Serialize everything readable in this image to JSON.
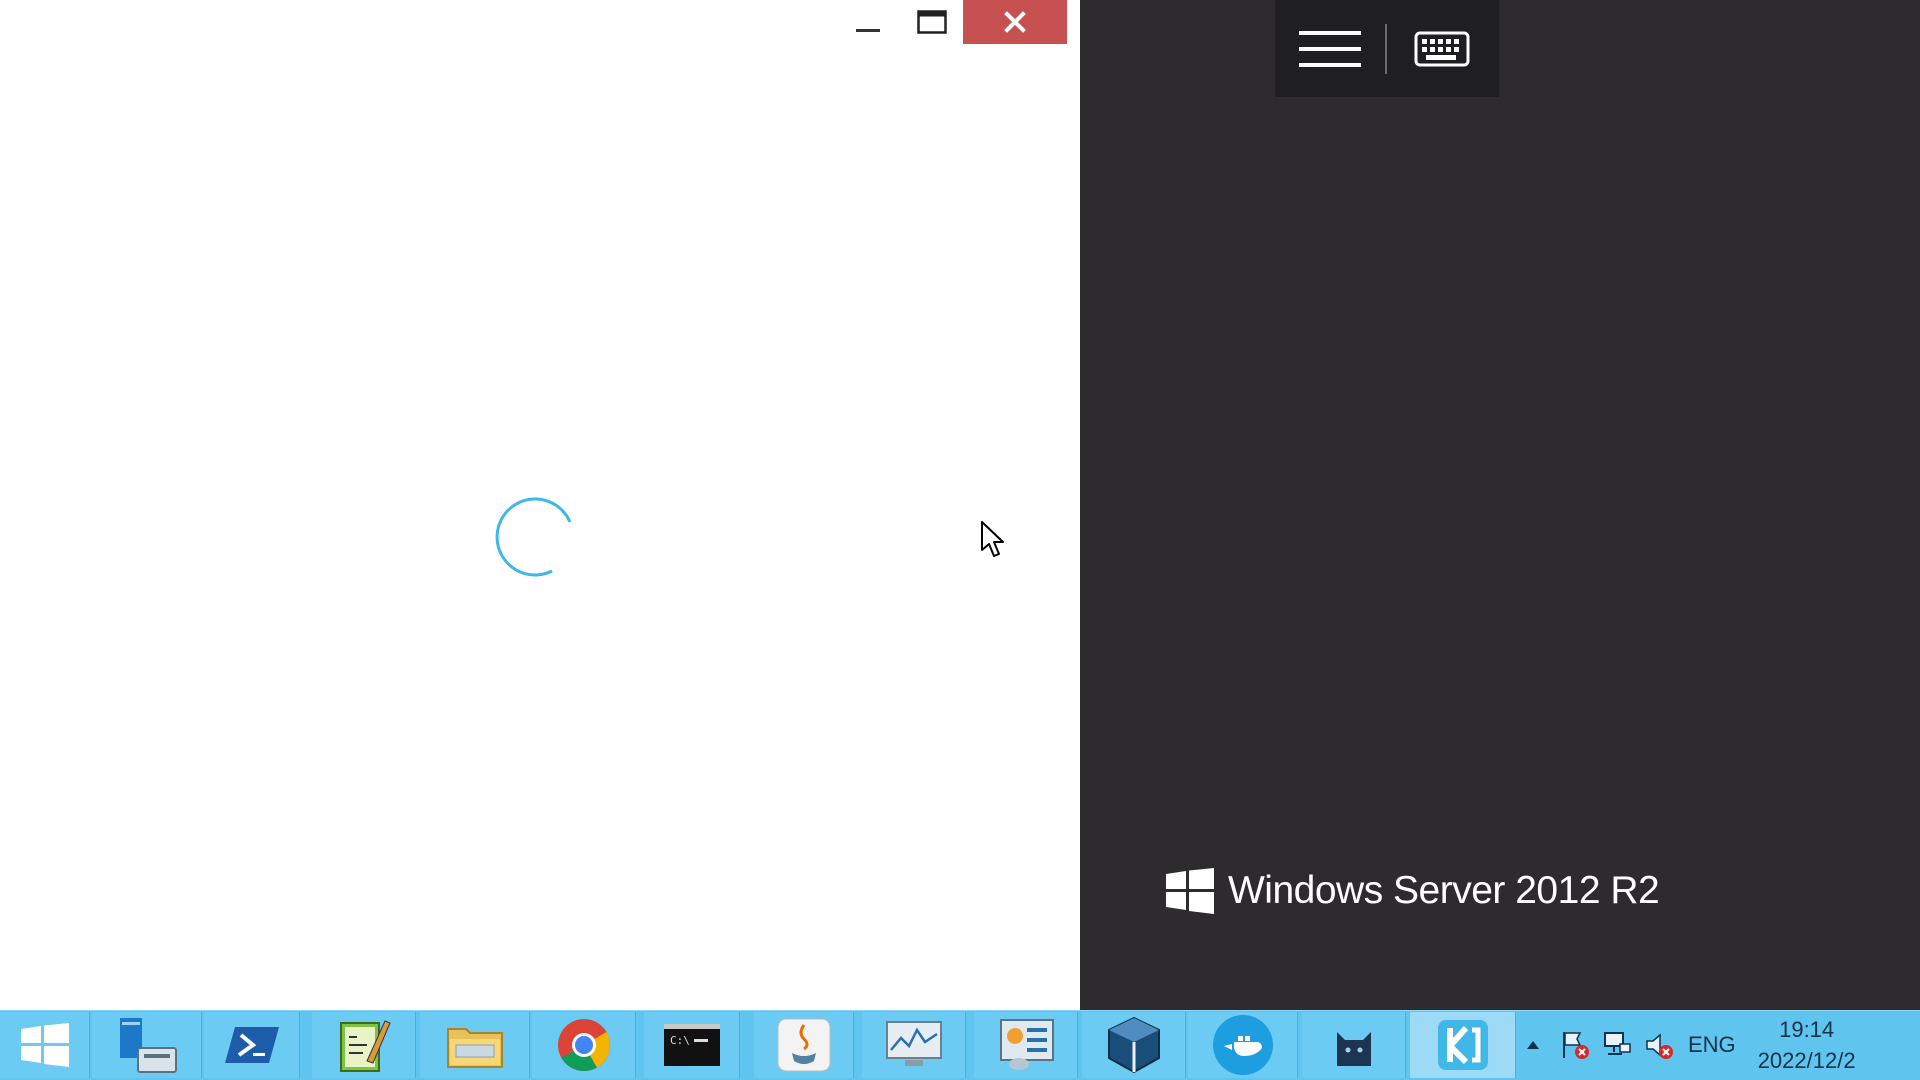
{
  "window": {
    "controls": {
      "minimize": "minimize",
      "maximize": "maximize",
      "close": "close"
    },
    "loading": true
  },
  "remote_bar": {
    "menu_icon": "hamburger-menu-icon",
    "keyboard_icon": "keyboard-icon"
  },
  "branding": {
    "text": "Windows Server 2012 R2",
    "logo_icon": "windows-logo-icon"
  },
  "taskbar": {
    "items": [
      {
        "name": "start-button",
        "icon": "windows-start-icon"
      },
      {
        "name": "server-manager",
        "icon": "server-manager-icon"
      },
      {
        "name": "powershell",
        "icon": "powershell-icon"
      },
      {
        "name": "notepad-plus-plus",
        "icon": "notepad-icon"
      },
      {
        "name": "file-explorer",
        "icon": "folder-icon"
      },
      {
        "name": "chrome",
        "icon": "chrome-icon"
      },
      {
        "name": "command-prompt",
        "icon": "cmd-icon"
      },
      {
        "name": "java",
        "icon": "java-icon"
      },
      {
        "name": "performance-monitor",
        "icon": "monitor-icon"
      },
      {
        "name": "control-panel",
        "icon": "control-panel-icon"
      },
      {
        "name": "virtualbox",
        "icon": "virtualbox-icon"
      },
      {
        "name": "docker",
        "icon": "docker-icon"
      },
      {
        "name": "cat-app",
        "icon": "cat-icon"
      },
      {
        "name": "kitematic",
        "icon": "kitematic-icon"
      }
    ],
    "tray": {
      "language": "ENG",
      "time": "19:14",
      "date": "2022/12/2"
    }
  },
  "colors": {
    "accent": "#5fc4ee",
    "close": "#c75050",
    "desktop": "#2e2b2f",
    "spinner": "#3fb8e8"
  }
}
